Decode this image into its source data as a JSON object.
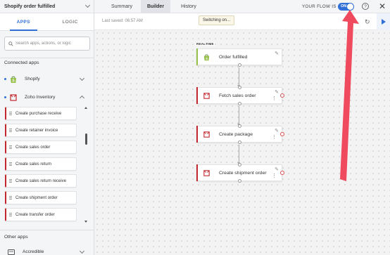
{
  "sidebar": {
    "flow_name": "Shopify order fulfilled",
    "tabs": [
      "APPS",
      "LOGIC"
    ],
    "search_placeholder": "Search apps, actions, or logic",
    "connected_label": "Connected apps",
    "apps": [
      {
        "name": "Shopify",
        "icon": "shopify-icon"
      },
      {
        "name": "Zoho Inventory",
        "icon": "zoho-inventory-icon"
      }
    ],
    "actions": [
      "Create purchase receive",
      "Create retainer invoice",
      "Create sales order",
      "Create sales return",
      "Create sales return receive",
      "Create shipment order",
      "Create transfer order"
    ],
    "other_label": "Other apps",
    "other_apps": [
      {
        "name": "Accredible",
        "icon": "accredible-icon"
      }
    ]
  },
  "topbar": {
    "tabs": [
      "Summary",
      "Builder",
      "History"
    ],
    "active_tab": "Builder",
    "flow_status_label": "YOUR FLOW IS",
    "toggle_label": "ON",
    "help_label": "?"
  },
  "toolbar": {
    "last_saved": "Last saved: 06:57 AM",
    "tooltip": "Switching on..."
  },
  "canvas": {
    "trigger_badge": "REALTIME",
    "nodes": [
      {
        "label": "Order fulfilled",
        "app": "Shopify",
        "color": "#95bf47"
      },
      {
        "label": "Fetch sales order",
        "app": "Zoho Inventory",
        "color": "#c1272d"
      },
      {
        "label": "Create package",
        "app": "Zoho Inventory",
        "color": "#c1272d"
      },
      {
        "label": "Create shipment order",
        "app": "Zoho Inventory",
        "color": "#c1272d"
      }
    ]
  },
  "colors": {
    "accent": "#2f6fd6",
    "shopify": "#95bf47",
    "zoho": "#c1272d",
    "annotation_arrow": "#f04a5e"
  }
}
